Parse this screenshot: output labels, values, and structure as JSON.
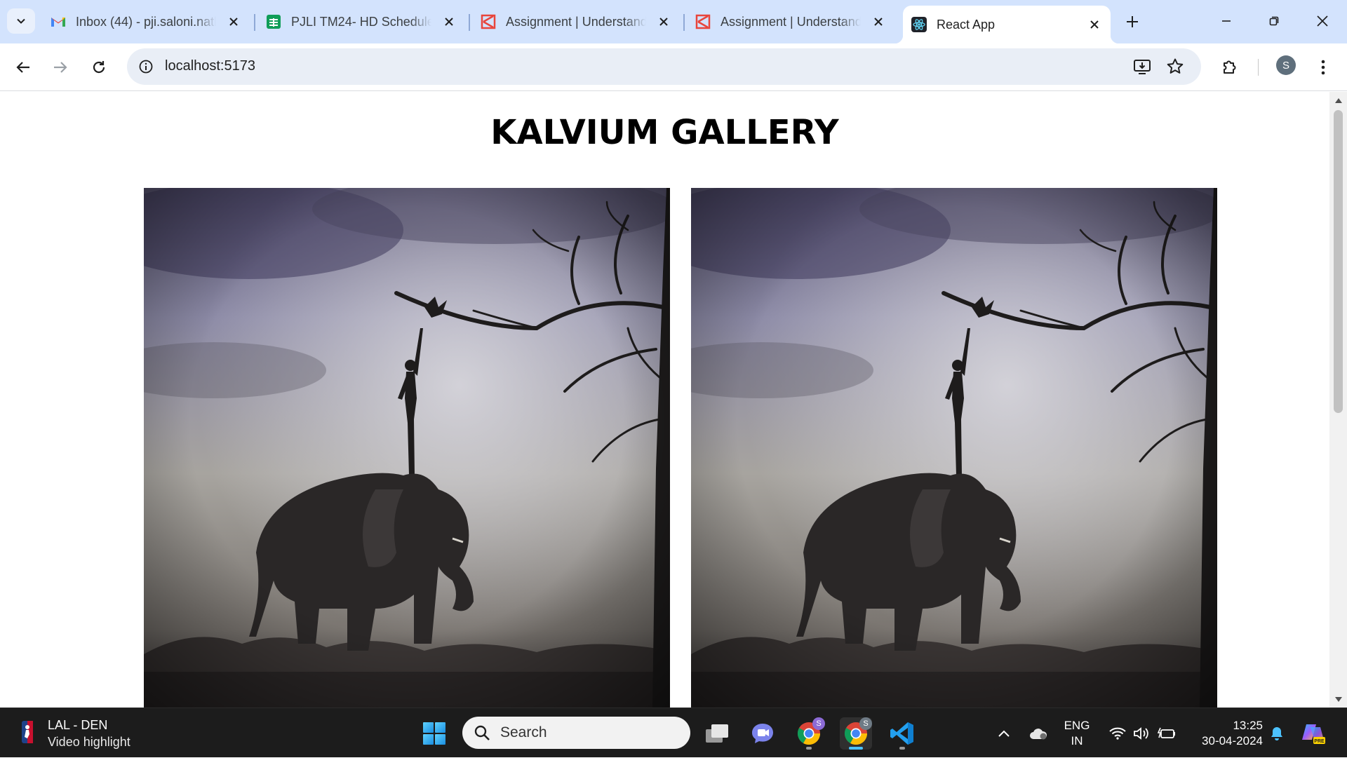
{
  "browser": {
    "tabs": [
      {
        "title": "Inbox (44) - pji.saloni.natl",
        "favicon": "gmail-icon",
        "active": false
      },
      {
        "title": "PJLI TM24- HD Schedule",
        "favicon": "sheets-icon",
        "active": false
      },
      {
        "title": "Assignment | Understand",
        "favicon": "kalvium-icon",
        "active": false
      },
      {
        "title": "Assignment | Understand",
        "favicon": "kalvium-icon",
        "active": false
      },
      {
        "title": "React App",
        "favicon": "react-icon",
        "active": true
      }
    ],
    "address": {
      "url": "localhost:5173"
    },
    "profile_initial": "S"
  },
  "page": {
    "title": "KALVIUM GALLERY",
    "images": [
      {
        "subject": "charcoal drawing of person on elephant reaching a leaf"
      },
      {
        "subject": "charcoal drawing of person on elephant reaching a leaf"
      }
    ]
  },
  "taskbar": {
    "news": {
      "headline": "LAL - DEN",
      "subtitle": "Video highlight"
    },
    "search_placeholder": "Search",
    "language": {
      "line1": "ENG",
      "line2": "IN"
    },
    "clock": {
      "time": "13:25",
      "date": "30-04-2024"
    },
    "chrome_badge_1": "S",
    "chrome_badge_2": "S"
  },
  "colors": {
    "tabstrip": "#d3e3fd",
    "omnibox": "#e9eef6",
    "taskbar": "#1c1c1c",
    "accent": "#4cc2ff"
  }
}
